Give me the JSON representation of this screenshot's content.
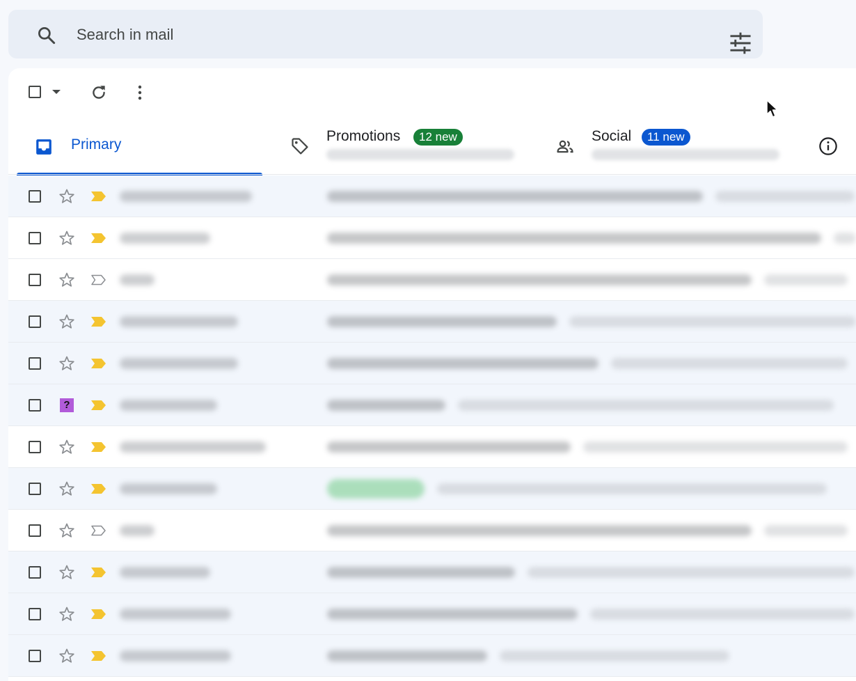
{
  "search": {
    "placeholder": "Search in mail",
    "value": "",
    "search_icon": "search-icon",
    "options_icon": "tune-icon"
  },
  "toolbar": {
    "icons": [
      "select-all-checkbox",
      "select-dropdown-caret",
      "refresh-icon",
      "more-vert-icon"
    ]
  },
  "tabs": {
    "primary": {
      "label": "Primary",
      "icon": "inbox-icon",
      "selected": true
    },
    "promotions": {
      "label": "Promotions",
      "badge": "12 new",
      "icon": "tag-icon"
    },
    "social": {
      "label": "Social",
      "badge": "11 new",
      "icon": "people-icon"
    },
    "info_icon": "info-icon"
  },
  "colors": {
    "accent": "#0b57d0",
    "promotions_badge": "#188038",
    "social_badge": "#0b57d0",
    "important_marker": "#f4c430",
    "row_alt_bg": "#f2f6fc"
  },
  "emails": [
    {
      "starred": false,
      "important": true
    },
    {
      "starred": false,
      "important": true
    },
    {
      "starred": false,
      "important": false
    },
    {
      "starred": false,
      "important": true
    },
    {
      "starred": false,
      "important": true
    },
    {
      "starred": false,
      "important": true,
      "marker": "?"
    },
    {
      "starred": false,
      "important": true
    },
    {
      "starred": false,
      "important": true
    },
    {
      "starred": false,
      "important": false
    },
    {
      "starred": false,
      "important": true
    },
    {
      "starred": false,
      "important": true
    },
    {
      "starred": false,
      "important": true
    }
  ]
}
